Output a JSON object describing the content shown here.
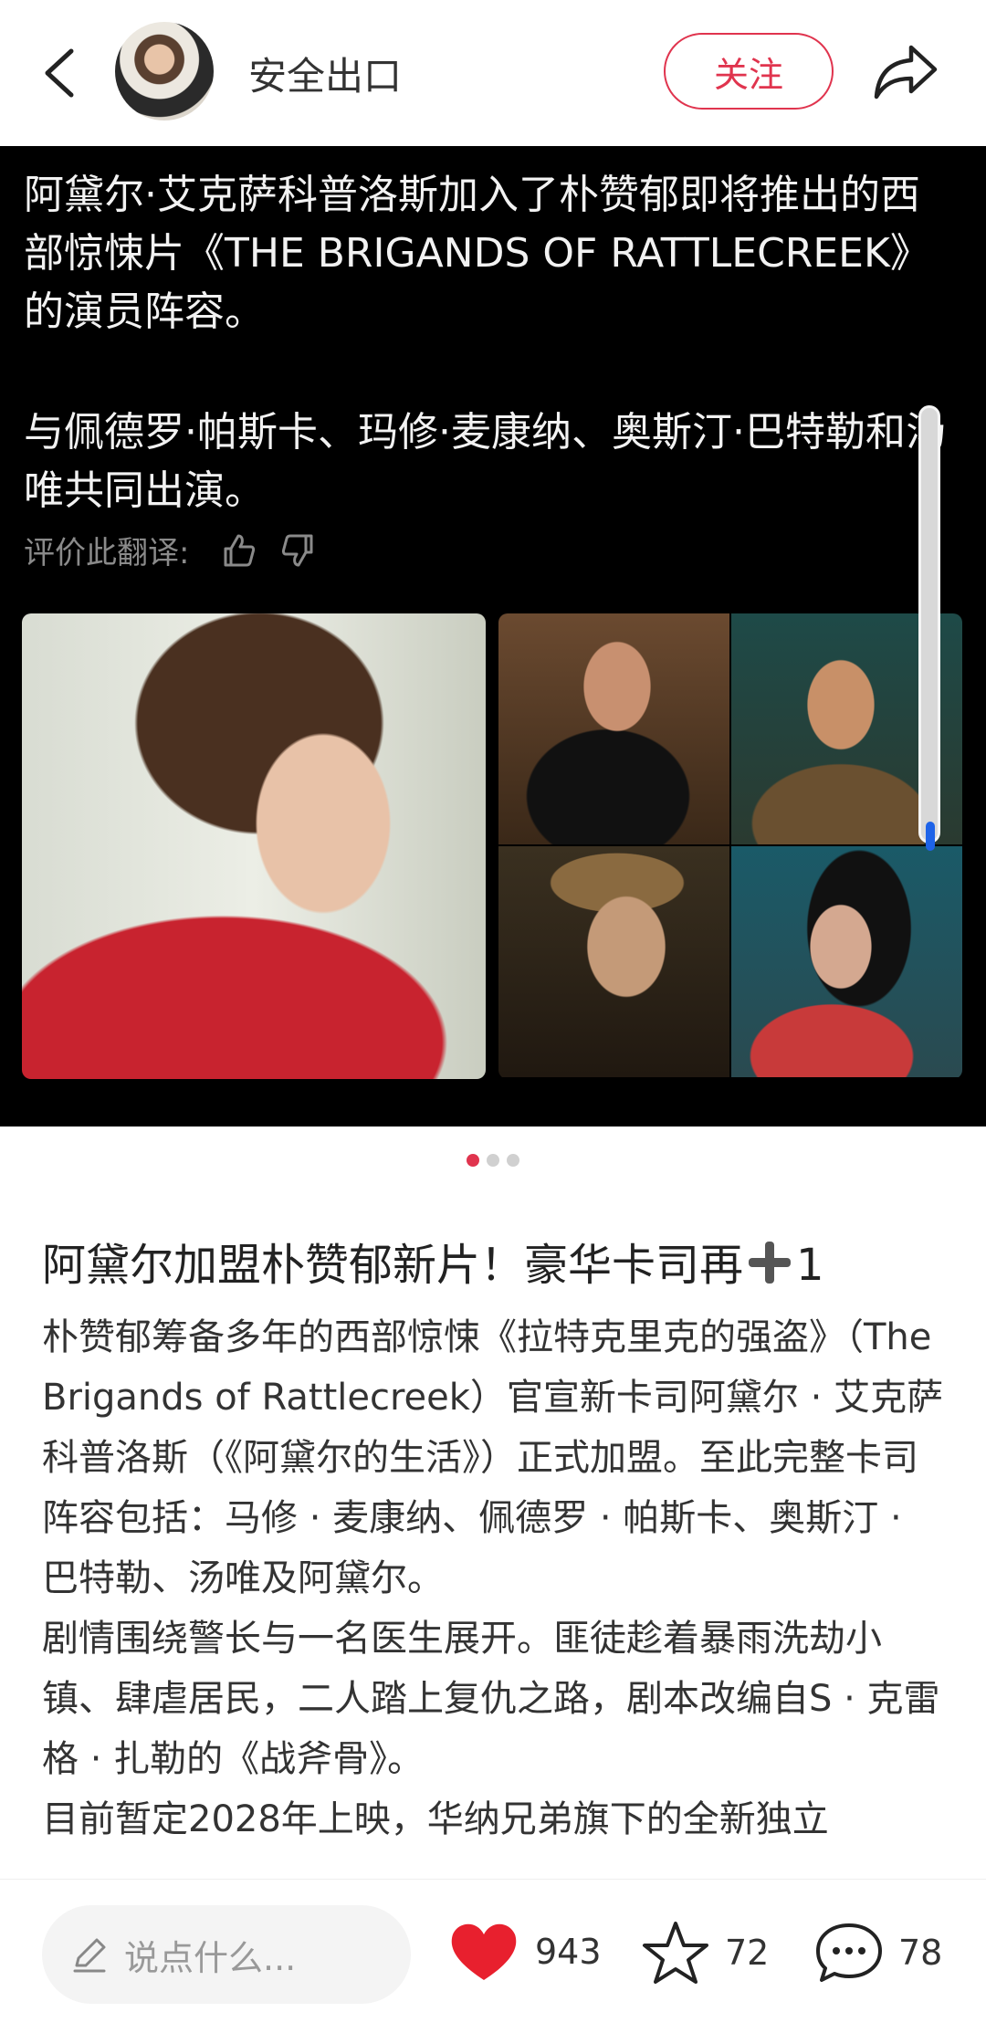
{
  "header": {
    "author": "安全出口",
    "follow_label": "关注"
  },
  "image_card": {
    "translated_paragraphs": [
      "阿黛尔·艾克萨科普洛斯加入了朴赞郁即将推出的西部惊悚片《THE BRIGANDS OF RATTLECREEK》的演员阵容。",
      "与佩德罗·帕斯卡、玛修·麦康纳、奥斯汀·巴特勒和汤唯共同出演。"
    ],
    "rate_label": "评价此翻译:"
  },
  "carousel": {
    "count": 3,
    "active_index": 0
  },
  "post": {
    "title_before": "阿黛尔加盟朴赞郁新片！豪华卡司再",
    "title_after": "1",
    "paragraphs": [
      "朴赞郁筹备多年的西部惊悚《拉特克里克的强盗》（The Brigands of Rattlecreek）官宣新卡司阿黛尔 · 艾克萨科普洛斯（《阿黛尔的生活》）正式加盟。至此完整卡司阵容包括：马修 · 麦康纳、佩德罗 · 帕斯卡、奥斯汀 · 巴特勒、汤唯及阿黛尔。",
      "剧情围绕警长与一名医生展开。匪徒趁着暴雨洗劫小镇、肆虐居民，二人踏上复仇之路，剧本改编自S · 克雷格 · 扎勒的《战斧骨》。",
      "目前暂定2028年上映，华纳兄弟旗下的全新独立"
    ]
  },
  "bottom_bar": {
    "comment_placeholder": "说点什么...",
    "likes": "943",
    "favorites": "72",
    "comments": "78"
  },
  "colors": {
    "accent": "#e0344e",
    "scroll_thumb": "#1e63e8"
  }
}
